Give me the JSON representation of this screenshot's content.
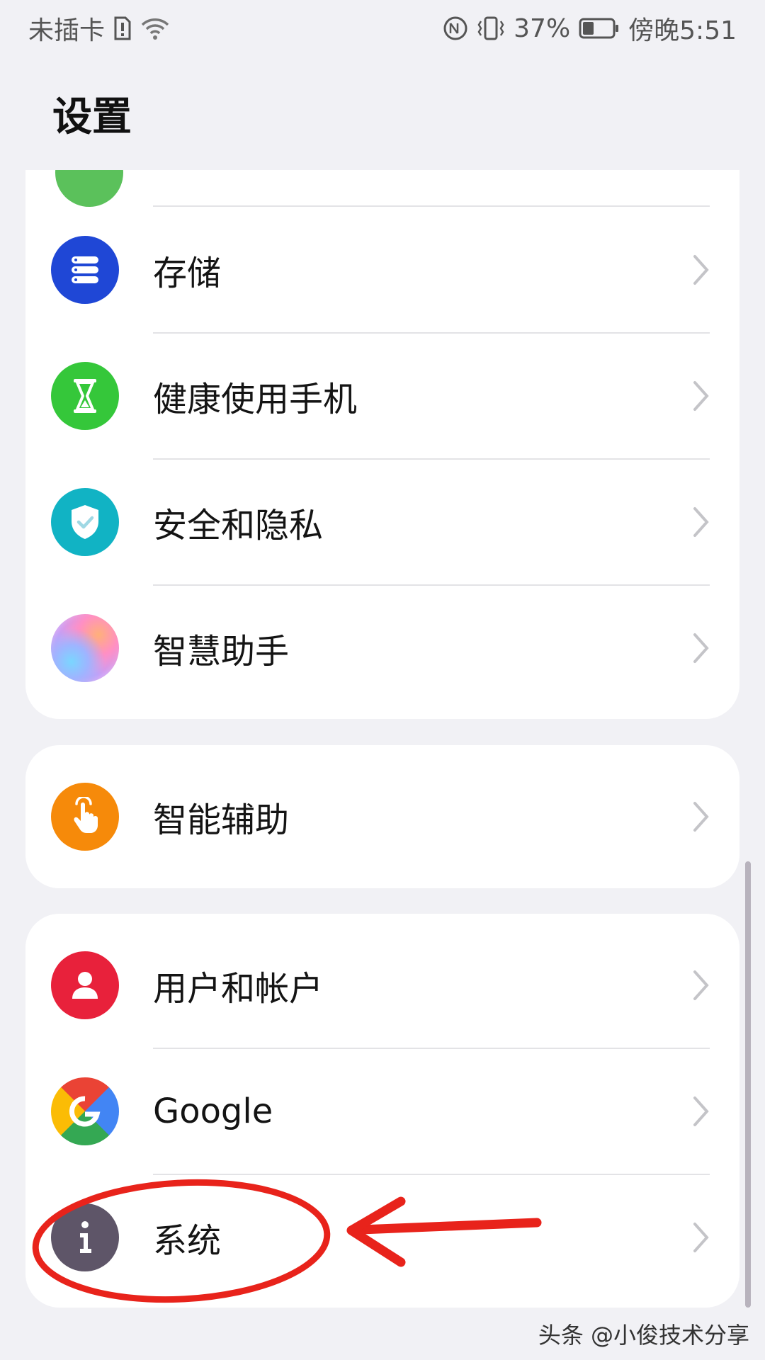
{
  "status_bar": {
    "carrier": "未插卡",
    "sim_alert_icon": "sim-alert-icon",
    "wifi_icon": "wifi-icon",
    "nfc_icon": "nfc-icon",
    "vibrate_icon": "vibrate-icon",
    "battery_percent": "37%",
    "battery_level": 0.37,
    "time": "傍晚5:51"
  },
  "page": {
    "title": "设置"
  },
  "groups": [
    {
      "items": [
        {
          "label": "存储",
          "icon": "storage-icon",
          "color": "#1f47d6"
        },
        {
          "label": "健康使用手机",
          "icon": "hourglass-icon",
          "color": "#35c73a"
        },
        {
          "label": "安全和隐私",
          "icon": "shield-icon",
          "color": "#11b3c4"
        },
        {
          "label": "智慧助手",
          "icon": "assistant-orb-icon",
          "color": "#d88ad8"
        }
      ]
    },
    {
      "items": [
        {
          "label": "智能辅助",
          "icon": "tap-hand-icon",
          "color": "#f68a0a"
        }
      ]
    },
    {
      "items": [
        {
          "label": "用户和帐户",
          "icon": "user-icon",
          "color": "#e8213b"
        },
        {
          "label": "Google",
          "icon": "google-icon",
          "color": "#4285f4"
        },
        {
          "label": "系统",
          "icon": "info-icon",
          "color": "#5e5568"
        }
      ]
    }
  ],
  "annotation": {
    "color": "#e8231b"
  },
  "watermark": "头条 @小俊技术分享"
}
